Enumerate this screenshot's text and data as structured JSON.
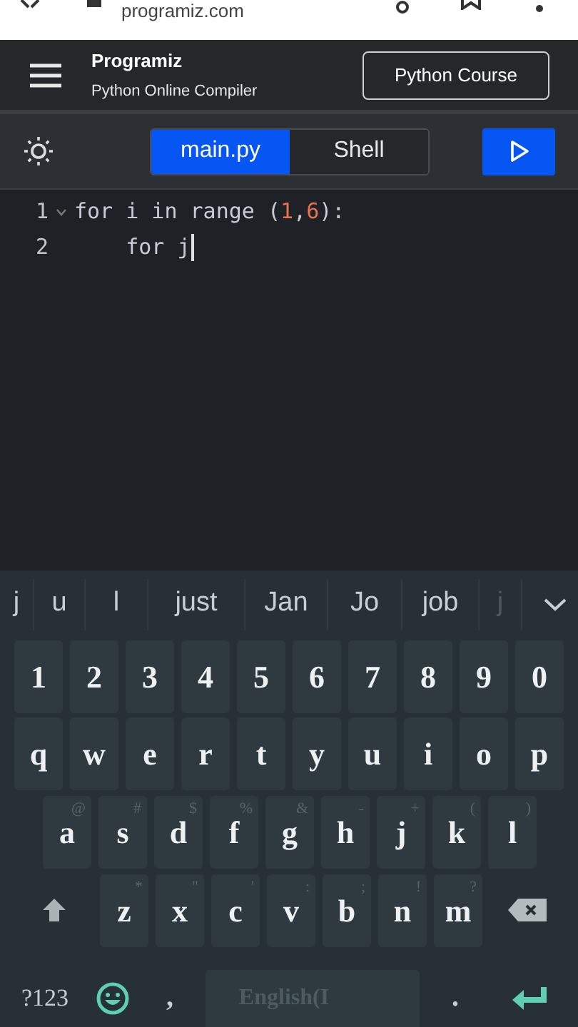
{
  "browser": {
    "url": "programiz.com"
  },
  "header": {
    "logo": "Programiz",
    "subtitle": "Python Online Compiler",
    "course_button": "Python Course"
  },
  "tabs": [
    {
      "label": "main.py",
      "selected": true
    },
    {
      "label": "Shell",
      "selected": false
    }
  ],
  "editor": {
    "lines": [
      {
        "number": "1",
        "expanded": true,
        "cursor": false,
        "tokens": [
          {
            "kind": "text",
            "text": "for i in range ("
          },
          {
            "kind": "number",
            "text": "1"
          },
          {
            "kind": "text",
            "text": ","
          },
          {
            "kind": "number",
            "text": "6"
          },
          {
            "kind": "text",
            "text": "):"
          }
        ]
      },
      {
        "number": "2",
        "expanded": false,
        "cursor": true,
        "tokens": [
          {
            "kind": "text",
            "text": "    for j"
          }
        ]
      }
    ]
  },
  "keyboard": {
    "suggestions": [
      {
        "text": "j",
        "faint": false
      },
      {
        "text": "u",
        "faint": false
      },
      {
        "text": "l",
        "faint": false
      },
      {
        "text": "just",
        "faint": false
      },
      {
        "text": "Jan",
        "faint": false
      },
      {
        "text": "Jo",
        "faint": false
      },
      {
        "text": "job",
        "faint": false
      },
      {
        "text": "j",
        "faint": true
      }
    ],
    "rows": [
      {
        "keys": [
          {
            "kind": "char",
            "label": "1"
          },
          {
            "kind": "char",
            "label": "2"
          },
          {
            "kind": "char",
            "label": "3"
          },
          {
            "kind": "char",
            "label": "4"
          },
          {
            "kind": "char",
            "label": "5"
          },
          {
            "kind": "char",
            "label": "6"
          },
          {
            "kind": "char",
            "label": "7"
          },
          {
            "kind": "char",
            "label": "8"
          },
          {
            "kind": "char",
            "label": "9"
          },
          {
            "kind": "char",
            "label": "0"
          }
        ]
      },
      {
        "keys": [
          {
            "kind": "char",
            "label": "q"
          },
          {
            "kind": "char",
            "label": "w"
          },
          {
            "kind": "char",
            "label": "e"
          },
          {
            "kind": "char",
            "label": "r"
          },
          {
            "kind": "char",
            "label": "t"
          },
          {
            "kind": "char",
            "label": "y"
          },
          {
            "kind": "char",
            "label": "u"
          },
          {
            "kind": "char",
            "label": "i"
          },
          {
            "kind": "char",
            "label": "o"
          },
          {
            "kind": "char",
            "label": "p"
          }
        ]
      },
      {
        "keys": [
          {
            "kind": "char",
            "label": "a",
            "hint": "@"
          },
          {
            "kind": "char",
            "label": "s",
            "hint": "#"
          },
          {
            "kind": "char",
            "label": "d",
            "hint": "$"
          },
          {
            "kind": "char",
            "label": "f",
            "hint": "%"
          },
          {
            "kind": "char",
            "label": "g",
            "hint": "&"
          },
          {
            "kind": "char",
            "label": "h",
            "hint": "-"
          },
          {
            "kind": "char",
            "label": "j",
            "hint": "+"
          },
          {
            "kind": "char",
            "label": "k",
            "hint": "("
          },
          {
            "kind": "char",
            "label": "l",
            "hint": ")"
          }
        ]
      },
      {
        "keys": [
          {
            "kind": "shift"
          },
          {
            "kind": "char",
            "label": "z",
            "hint": "*"
          },
          {
            "kind": "char",
            "label": "x",
            "hint": "\""
          },
          {
            "kind": "char",
            "label": "c",
            "hint": "'"
          },
          {
            "kind": "char",
            "label": "v",
            "hint": ":"
          },
          {
            "kind": "char",
            "label": "b",
            "hint": ";"
          },
          {
            "kind": "char",
            "label": "n",
            "hint": "!"
          },
          {
            "kind": "char",
            "label": "m",
            "hint": "?"
          },
          {
            "kind": "backspace"
          }
        ]
      },
      {
        "keys": [
          {
            "kind": "symbols",
            "label": "?123"
          },
          {
            "kind": "emoji"
          },
          {
            "kind": "punct",
            "label": ","
          },
          {
            "kind": "space",
            "label": "English(I"
          },
          {
            "kind": "punct",
            "label": "."
          },
          {
            "kind": "enter"
          }
        ]
      }
    ]
  }
}
